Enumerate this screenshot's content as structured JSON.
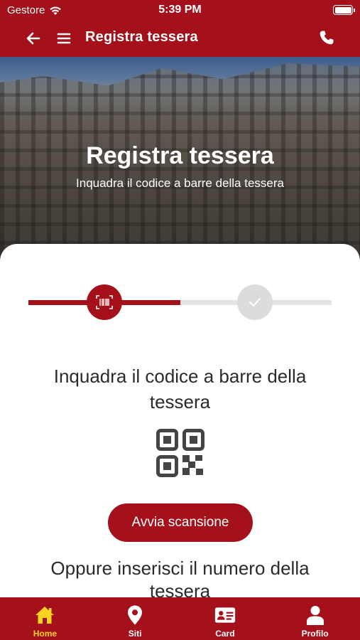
{
  "status": {
    "carrier": "Gestore",
    "time": "5:39 PM"
  },
  "nav": {
    "title": "Registra tessera"
  },
  "hero": {
    "heading": "Registra tessera",
    "subtitle": "Inquadra il codice a barre della tessera"
  },
  "stepper": {
    "current_step": 1,
    "total_steps": 2
  },
  "main": {
    "instruction": "Inquadra il codice a barre della tessera",
    "scan_button": "Avvia scansione",
    "alternative": "Oppure inserisci il numero della tessera"
  },
  "tabs": [
    {
      "label": "Home",
      "icon": "home-icon",
      "active": true
    },
    {
      "label": "Siti",
      "icon": "map-pin-icon",
      "active": false
    },
    {
      "label": "Card",
      "icon": "id-card-icon",
      "active": false
    },
    {
      "label": "Profilo",
      "icon": "user-icon",
      "active": false
    }
  ],
  "colors": {
    "brand": "#a4111b",
    "active_tab": "#ffd21f",
    "inactive_step": "#dcdcdc"
  }
}
